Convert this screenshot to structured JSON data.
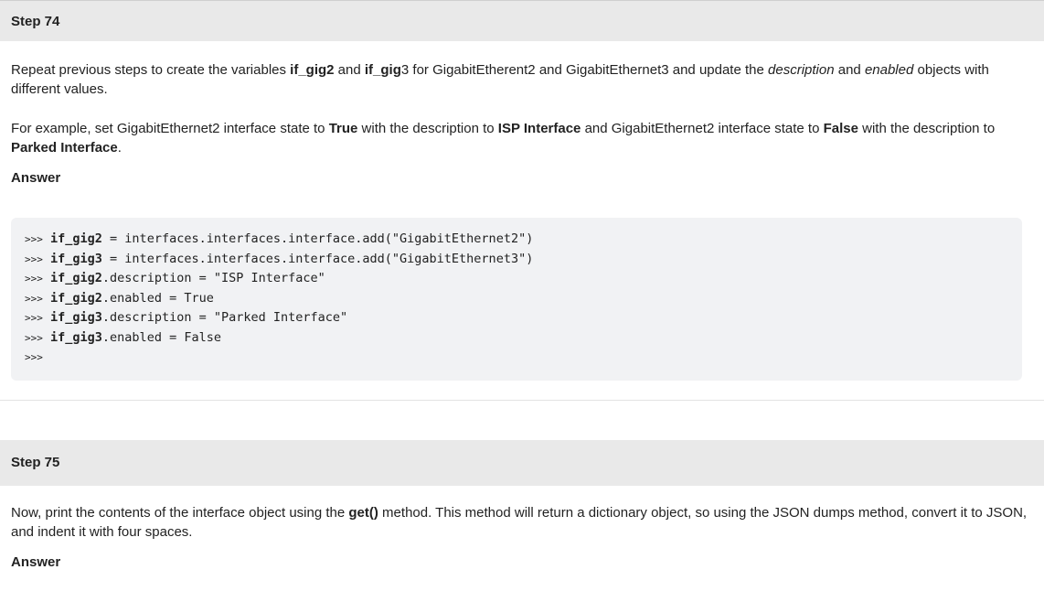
{
  "step74": {
    "title": "Step 74",
    "para1": {
      "t1": "Repeat previous steps to create the variables ",
      "b1": "if_gig2",
      "t2": " and ",
      "b2": "if_gig",
      "t3": "3 for GigabitEtherent2 and GigabitEthernet3 and update the ",
      "i1": "description",
      "t4": " and ",
      "i2": "enabled",
      "t5": " objects with different values."
    },
    "para2": {
      "t1": "For example, set GigabitEthernet2 interface state to ",
      "b1": "True",
      "t2": " with the description to ",
      "b2": "ISP Interface",
      "t3": " and GigabitEthernet2 interface state to ",
      "b3": "False",
      "t4": " with the description to ",
      "b4": "Parked Interface",
      "t5": "."
    },
    "answer_label": "Answer",
    "code_lines": [
      {
        "prompt": ">>>",
        "var": "if_gig2",
        "rest": " = interfaces.interfaces.interface.add(\"GigabitEthernet2\")"
      },
      {
        "prompt": ">>>",
        "var": "if_gig3",
        "rest": " = interfaces.interfaces.interface.add(\"GigabitEthernet3\")"
      },
      {
        "prompt": ">>>",
        "var": "if_gig2",
        "rest": ".description = \"ISP Interface\""
      },
      {
        "prompt": ">>>",
        "var": "if_gig2",
        "rest": ".enabled = True"
      },
      {
        "prompt": ">>>",
        "var": "if_gig3",
        "rest": ".description = \"Parked Interface\""
      },
      {
        "prompt": ">>>",
        "var": "if_gig3",
        "rest": ".enabled = False"
      },
      {
        "prompt": ">>>",
        "var": "",
        "rest": ""
      }
    ]
  },
  "step75": {
    "title": "Step 75",
    "para1": {
      "t1": "Now, print the contents of the interface object using the ",
      "b1": "get()",
      "t2": " method. This method will return a dictionary object, so using the JSON dumps method, convert it to JSON, and indent it with four spaces."
    },
    "answer_label": "Answer"
  }
}
